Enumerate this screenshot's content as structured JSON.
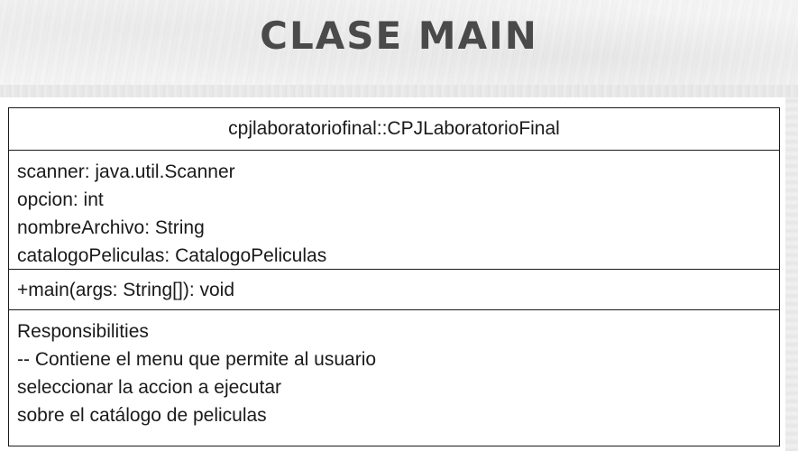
{
  "slide": {
    "title": "CLASE MAIN"
  },
  "uml_class": {
    "name": "cpjlaboratoriofinal::CPJLaboratorioFinal",
    "attributes": [
      "scanner: java.util.Scanner",
      "opcion: int",
      "nombreArchivo: String",
      "catalogoPeliculas: CatalogoPeliculas"
    ],
    "operations": [
      "+main(args: String[]): void"
    ],
    "responsibilities": [
      "Responsibilities",
      "-- Contiene el menu que permite al usuario",
      "seleccionar la accion a ejecutar",
      "sobre el catálogo de peliculas"
    ]
  }
}
